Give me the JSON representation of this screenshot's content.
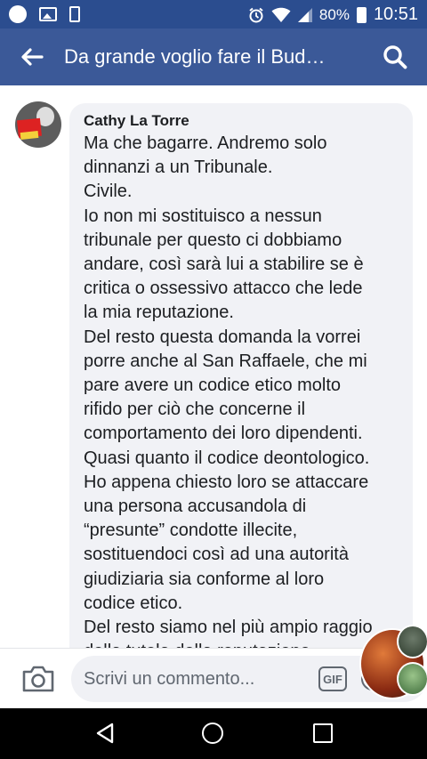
{
  "status_bar": {
    "battery": "80%",
    "time": "10:51",
    "icons": [
      "notification-dot-icon",
      "gallery-icon",
      "battery-saver-icon",
      "alarm-icon",
      "wifi-icon",
      "signal-icon",
      "battery-icon"
    ]
  },
  "app_bar": {
    "title": "Da grande voglio fare il Bud…",
    "back_icon": "arrow-left-icon",
    "search_icon": "search-icon"
  },
  "comment": {
    "author": "Cathy La Torre",
    "lines": [
      "Ma che bagarre. Andremo solo",
      "dinnanzi a un Tribunale.",
      "Civile.",
      "Io non mi sostituisco a nessun",
      "tribunale per questo ci dobbiamo",
      "andare, così sarà lui a stabilire se è",
      "critica o ossessivo attacco che lede",
      "la mia reputazione.",
      "Del resto questa domanda la vorrei",
      "porre anche al San Raffaele, che mi",
      "pare avere un codice etico molto",
      "rifido per ciò che concerne il",
      "comportamento dei loro dipendenti.",
      "Quasi quanto il codice deontologico.",
      "Ho appena chiesto loro se attaccare",
      "una persona accusandola di",
      "“presunte” condotte illecite,",
      "sostituendoci così ad una autorità",
      "giudiziaria sia conforme al loro",
      "codice etico.",
      "Del resto siamo nel più ampio raggio",
      "della tutela della reputazione..."
    ]
  },
  "composer": {
    "placeholder": "Scrivi un commento...",
    "gif_label": "GIF",
    "camera_icon": "camera-icon",
    "sticker_icon": "sticker-icon"
  },
  "nav_bar": {
    "icons": [
      "nav-back-icon",
      "nav-home-icon",
      "nav-recent-apps-icon"
    ]
  },
  "colors": {
    "status_bar": "#2b4d8f",
    "app_bar": "#3b5998",
    "bubble": "#f1f2f6",
    "text": "#1c1e21",
    "placeholder": "#606770"
  }
}
